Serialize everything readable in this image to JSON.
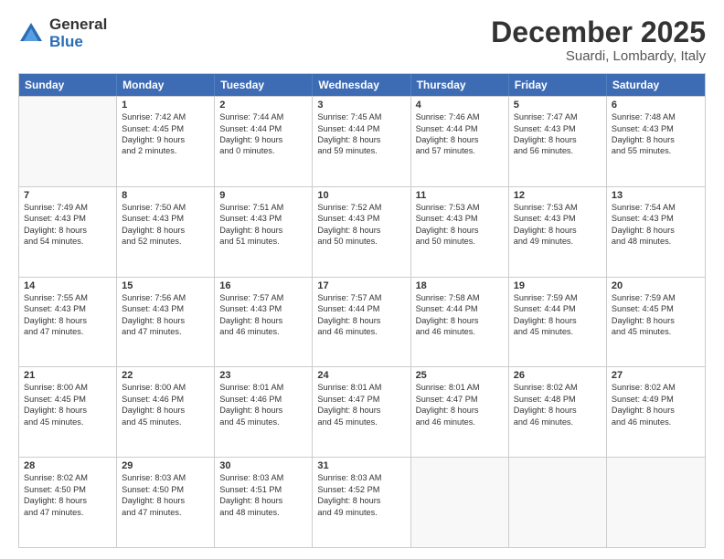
{
  "logo": {
    "general": "General",
    "blue": "Blue"
  },
  "title": "December 2025",
  "subtitle": "Suardi, Lombardy, Italy",
  "header_days": [
    "Sunday",
    "Monday",
    "Tuesday",
    "Wednesday",
    "Thursday",
    "Friday",
    "Saturday"
  ],
  "weeks": [
    [
      {
        "day": "",
        "sunrise": "",
        "sunset": "",
        "daylight": "",
        "daylight2": ""
      },
      {
        "day": "1",
        "sunrise": "Sunrise: 7:42 AM",
        "sunset": "Sunset: 4:45 PM",
        "daylight": "Daylight: 9 hours",
        "daylight2": "and 2 minutes."
      },
      {
        "day": "2",
        "sunrise": "Sunrise: 7:44 AM",
        "sunset": "Sunset: 4:44 PM",
        "daylight": "Daylight: 9 hours",
        "daylight2": "and 0 minutes."
      },
      {
        "day": "3",
        "sunrise": "Sunrise: 7:45 AM",
        "sunset": "Sunset: 4:44 PM",
        "daylight": "Daylight: 8 hours",
        "daylight2": "and 59 minutes."
      },
      {
        "day": "4",
        "sunrise": "Sunrise: 7:46 AM",
        "sunset": "Sunset: 4:44 PM",
        "daylight": "Daylight: 8 hours",
        "daylight2": "and 57 minutes."
      },
      {
        "day": "5",
        "sunrise": "Sunrise: 7:47 AM",
        "sunset": "Sunset: 4:43 PM",
        "daylight": "Daylight: 8 hours",
        "daylight2": "and 56 minutes."
      },
      {
        "day": "6",
        "sunrise": "Sunrise: 7:48 AM",
        "sunset": "Sunset: 4:43 PM",
        "daylight": "Daylight: 8 hours",
        "daylight2": "and 55 minutes."
      }
    ],
    [
      {
        "day": "7",
        "sunrise": "Sunrise: 7:49 AM",
        "sunset": "Sunset: 4:43 PM",
        "daylight": "Daylight: 8 hours",
        "daylight2": "and 54 minutes."
      },
      {
        "day": "8",
        "sunrise": "Sunrise: 7:50 AM",
        "sunset": "Sunset: 4:43 PM",
        "daylight": "Daylight: 8 hours",
        "daylight2": "and 52 minutes."
      },
      {
        "day": "9",
        "sunrise": "Sunrise: 7:51 AM",
        "sunset": "Sunset: 4:43 PM",
        "daylight": "Daylight: 8 hours",
        "daylight2": "and 51 minutes."
      },
      {
        "day": "10",
        "sunrise": "Sunrise: 7:52 AM",
        "sunset": "Sunset: 4:43 PM",
        "daylight": "Daylight: 8 hours",
        "daylight2": "and 50 minutes."
      },
      {
        "day": "11",
        "sunrise": "Sunrise: 7:53 AM",
        "sunset": "Sunset: 4:43 PM",
        "daylight": "Daylight: 8 hours",
        "daylight2": "and 50 minutes."
      },
      {
        "day": "12",
        "sunrise": "Sunrise: 7:53 AM",
        "sunset": "Sunset: 4:43 PM",
        "daylight": "Daylight: 8 hours",
        "daylight2": "and 49 minutes."
      },
      {
        "day": "13",
        "sunrise": "Sunrise: 7:54 AM",
        "sunset": "Sunset: 4:43 PM",
        "daylight": "Daylight: 8 hours",
        "daylight2": "and 48 minutes."
      }
    ],
    [
      {
        "day": "14",
        "sunrise": "Sunrise: 7:55 AM",
        "sunset": "Sunset: 4:43 PM",
        "daylight": "Daylight: 8 hours",
        "daylight2": "and 47 minutes."
      },
      {
        "day": "15",
        "sunrise": "Sunrise: 7:56 AM",
        "sunset": "Sunset: 4:43 PM",
        "daylight": "Daylight: 8 hours",
        "daylight2": "and 47 minutes."
      },
      {
        "day": "16",
        "sunrise": "Sunrise: 7:57 AM",
        "sunset": "Sunset: 4:43 PM",
        "daylight": "Daylight: 8 hours",
        "daylight2": "and 46 minutes."
      },
      {
        "day": "17",
        "sunrise": "Sunrise: 7:57 AM",
        "sunset": "Sunset: 4:44 PM",
        "daylight": "Daylight: 8 hours",
        "daylight2": "and 46 minutes."
      },
      {
        "day": "18",
        "sunrise": "Sunrise: 7:58 AM",
        "sunset": "Sunset: 4:44 PM",
        "daylight": "Daylight: 8 hours",
        "daylight2": "and 46 minutes."
      },
      {
        "day": "19",
        "sunrise": "Sunrise: 7:59 AM",
        "sunset": "Sunset: 4:44 PM",
        "daylight": "Daylight: 8 hours",
        "daylight2": "and 45 minutes."
      },
      {
        "day": "20",
        "sunrise": "Sunrise: 7:59 AM",
        "sunset": "Sunset: 4:45 PM",
        "daylight": "Daylight: 8 hours",
        "daylight2": "and 45 minutes."
      }
    ],
    [
      {
        "day": "21",
        "sunrise": "Sunrise: 8:00 AM",
        "sunset": "Sunset: 4:45 PM",
        "daylight": "Daylight: 8 hours",
        "daylight2": "and 45 minutes."
      },
      {
        "day": "22",
        "sunrise": "Sunrise: 8:00 AM",
        "sunset": "Sunset: 4:46 PM",
        "daylight": "Daylight: 8 hours",
        "daylight2": "and 45 minutes."
      },
      {
        "day": "23",
        "sunrise": "Sunrise: 8:01 AM",
        "sunset": "Sunset: 4:46 PM",
        "daylight": "Daylight: 8 hours",
        "daylight2": "and 45 minutes."
      },
      {
        "day": "24",
        "sunrise": "Sunrise: 8:01 AM",
        "sunset": "Sunset: 4:47 PM",
        "daylight": "Daylight: 8 hours",
        "daylight2": "and 45 minutes."
      },
      {
        "day": "25",
        "sunrise": "Sunrise: 8:01 AM",
        "sunset": "Sunset: 4:47 PM",
        "daylight": "Daylight: 8 hours",
        "daylight2": "and 46 minutes."
      },
      {
        "day": "26",
        "sunrise": "Sunrise: 8:02 AM",
        "sunset": "Sunset: 4:48 PM",
        "daylight": "Daylight: 8 hours",
        "daylight2": "and 46 minutes."
      },
      {
        "day": "27",
        "sunrise": "Sunrise: 8:02 AM",
        "sunset": "Sunset: 4:49 PM",
        "daylight": "Daylight: 8 hours",
        "daylight2": "and 46 minutes."
      }
    ],
    [
      {
        "day": "28",
        "sunrise": "Sunrise: 8:02 AM",
        "sunset": "Sunset: 4:50 PM",
        "daylight": "Daylight: 8 hours",
        "daylight2": "and 47 minutes."
      },
      {
        "day": "29",
        "sunrise": "Sunrise: 8:03 AM",
        "sunset": "Sunset: 4:50 PM",
        "daylight": "Daylight: 8 hours",
        "daylight2": "and 47 minutes."
      },
      {
        "day": "30",
        "sunrise": "Sunrise: 8:03 AM",
        "sunset": "Sunset: 4:51 PM",
        "daylight": "Daylight: 8 hours",
        "daylight2": "and 48 minutes."
      },
      {
        "day": "31",
        "sunrise": "Sunrise: 8:03 AM",
        "sunset": "Sunset: 4:52 PM",
        "daylight": "Daylight: 8 hours",
        "daylight2": "and 49 minutes."
      },
      {
        "day": "",
        "sunrise": "",
        "sunset": "",
        "daylight": "",
        "daylight2": ""
      },
      {
        "day": "",
        "sunrise": "",
        "sunset": "",
        "daylight": "",
        "daylight2": ""
      },
      {
        "day": "",
        "sunrise": "",
        "sunset": "",
        "daylight": "",
        "daylight2": ""
      }
    ]
  ]
}
